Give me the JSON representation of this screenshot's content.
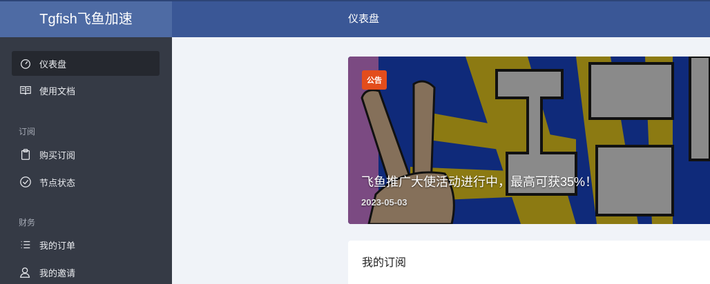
{
  "app": {
    "brand": "Tgfish飞鱼加速",
    "page_title": "仪表盘"
  },
  "sidebar": {
    "items": [
      {
        "label": "仪表盘",
        "icon": "dashboard-icon",
        "active": true
      },
      {
        "label": "使用文档",
        "icon": "book-icon"
      }
    ],
    "sections": [
      {
        "label": "订阅",
        "items": [
          {
            "label": "购买订阅",
            "icon": "clipboard-icon"
          },
          {
            "label": "节点状态",
            "icon": "check-circle-icon"
          }
        ]
      },
      {
        "label": "财务",
        "items": [
          {
            "label": "我的订单",
            "icon": "list-icon"
          },
          {
            "label": "我的邀请",
            "icon": "users-icon"
          }
        ]
      }
    ]
  },
  "notice": {
    "badge": "公告",
    "title": "飞鱼推广大使活动进行中，最高可获35%！",
    "date": "2023-05-03"
  },
  "subscription": {
    "title": "我的订阅"
  },
  "colors": {
    "topbar": "#3a5796",
    "sidebar": "#353a45",
    "badge": "#e34d1c"
  }
}
